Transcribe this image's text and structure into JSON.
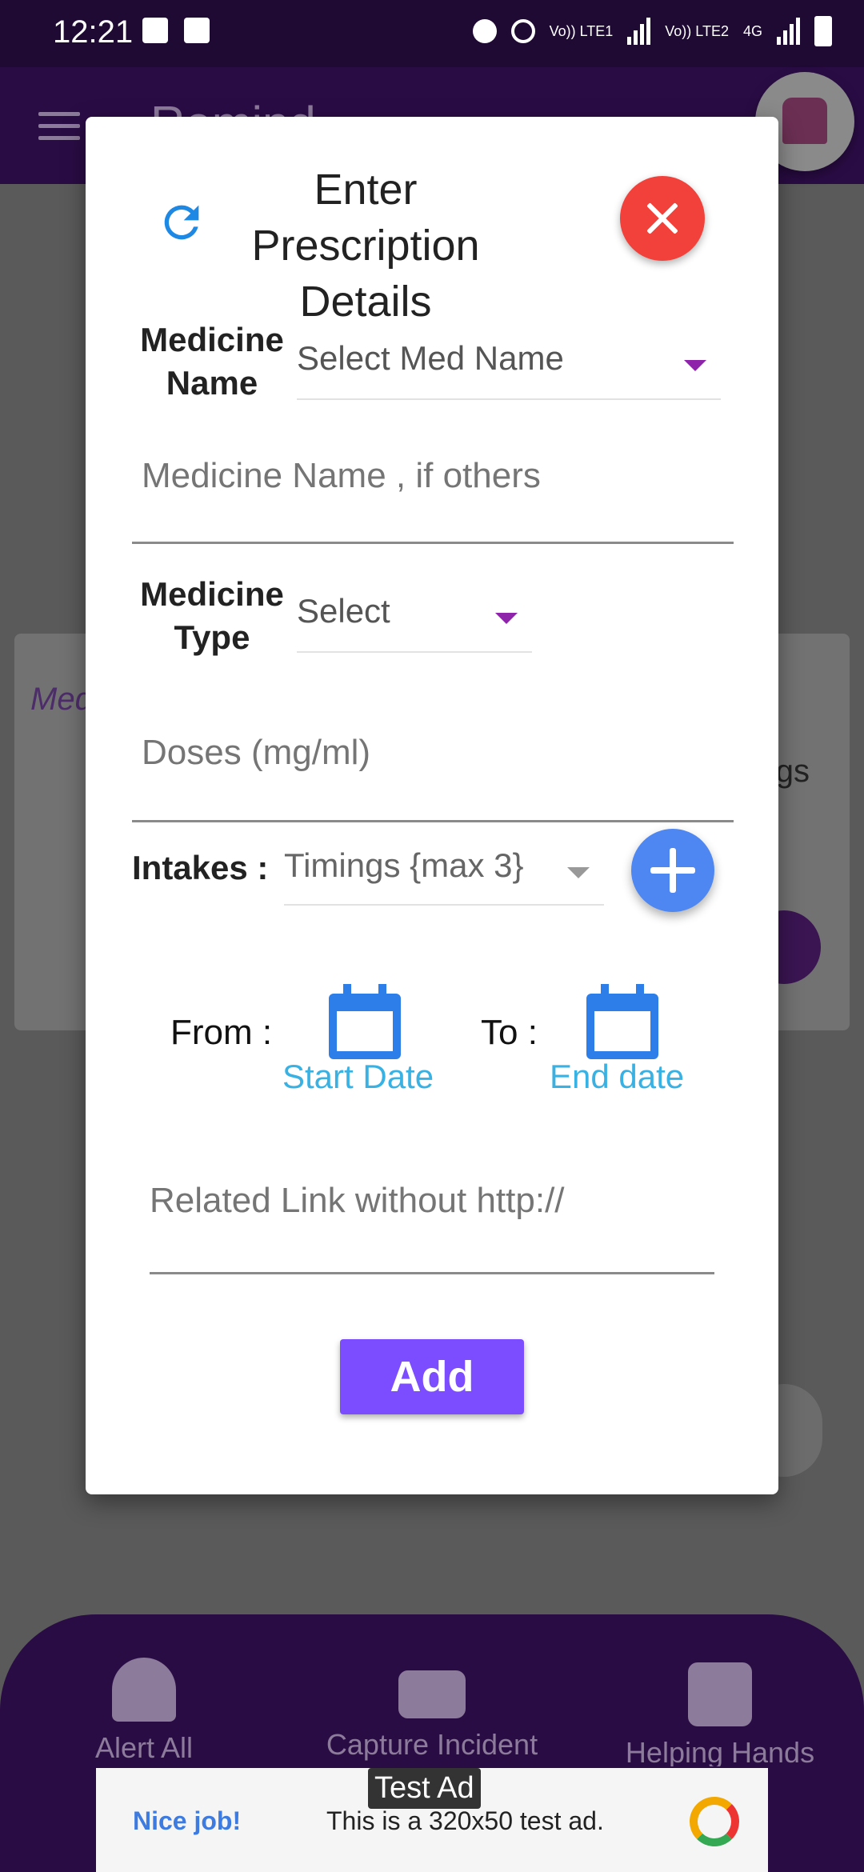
{
  "status_bar": {
    "time": "12:21",
    "network_labels": [
      "Vo)) LTE1",
      "Vo)) LTE2",
      "4G"
    ]
  },
  "background": {
    "title": "Remind",
    "card_label": "Med",
    "card_side_text": "ngs",
    "bottom_nav": [
      {
        "label": "Alert All",
        "icon": "bell-plus-icon"
      },
      {
        "label": "Capture Incident",
        "icon": "video-camera-icon"
      },
      {
        "label": "Helping Hands",
        "icon": "contact-badge-icon"
      }
    ],
    "ad": {
      "badge": "Test Ad",
      "headline": "Nice job!",
      "text": "This is a 320x50 test ad."
    }
  },
  "dialog": {
    "title": "Enter Prescription Details",
    "medicine_name_label": "Medicine Name",
    "medicine_name_select": "Select Med Name",
    "medicine_name_other_placeholder": "Medicine Name , if others",
    "medicine_type_label": "Medicine Type",
    "medicine_type_select": "Select",
    "doses_placeholder": "Doses  (mg/ml)",
    "intakes_label": "Intakes :",
    "intakes_select": "Timings {max 3}",
    "from_label": "From :",
    "to_label": "To :",
    "start_date": "Start Date",
    "end_date": "End date",
    "link_placeholder": "Related Link without http://",
    "add_button": "Add"
  },
  "colors": {
    "accent_purple": "#7c4dff",
    "close_red": "#f2413a",
    "fab_blue": "#4e86f2",
    "calendar_blue": "#2d7ee8",
    "date_link": "#3ab1e3",
    "caret_purple": "#8e24aa"
  }
}
